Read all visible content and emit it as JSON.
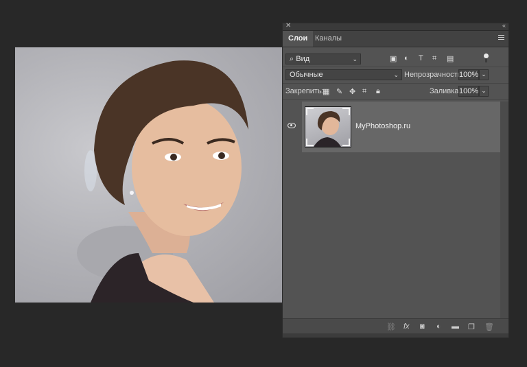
{
  "panel": {
    "tabs": [
      {
        "label": "Слои",
        "active": true
      },
      {
        "label": "Каналы",
        "active": false
      }
    ],
    "filter": {
      "kind_label": "Вид",
      "icons": [
        "image-filter-icon",
        "adjustment-filter-icon",
        "type-filter-icon",
        "shape-filter-icon",
        "smart-object-filter-icon"
      ]
    },
    "blend": {
      "mode": "Обычные",
      "opacity_label": "Непрозрачность:",
      "opacity_value": "100%"
    },
    "lock": {
      "label": "Закрепить:",
      "icons": [
        "lock-transparent-icon",
        "lock-image-icon",
        "lock-position-icon",
        "lock-artboard-icon",
        "lock-all-icon"
      ],
      "fill_label": "Заливка:",
      "fill_value": "100%"
    },
    "layers": [
      {
        "name": "MyPhotoshop.ru",
        "visible": true,
        "selected": true
      }
    ],
    "footer_icons": [
      "link-layers-icon",
      "fx-icon",
      "layer-mask-icon",
      "adjustment-layer-icon",
      "group-folder-icon",
      "new-layer-icon",
      "trash-icon"
    ],
    "footer_fx_text": "fx"
  },
  "colors": {
    "app_background": "#282828",
    "panel_background": "#535353",
    "selected_layer": "#676767"
  }
}
